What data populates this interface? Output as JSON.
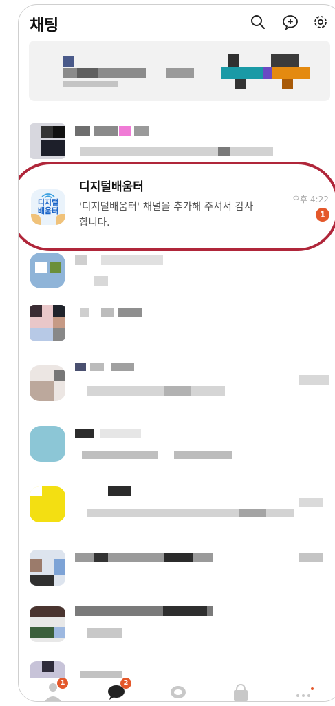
{
  "header": {
    "title": "채팅",
    "icons": [
      "search-icon",
      "new-chat-icon",
      "settings-icon"
    ]
  },
  "highlighted_chat": {
    "avatar_logo_text": "디지털\n배움터",
    "name": "디지털배움터",
    "preview": "'디지털배움터' 채널을 추가해 주셔서 감사합니다.",
    "time": "오후 4:22",
    "unread_count": "1",
    "highlight_color": "#b0263a"
  },
  "tabbar": {
    "tabs": [
      {
        "name": "friends",
        "icon": "person-icon",
        "badge": "1"
      },
      {
        "name": "chats",
        "icon": "chat-bubble-icon",
        "badge": "2",
        "active": true
      },
      {
        "name": "open-chat",
        "icon": "open-chat-icon"
      },
      {
        "name": "shopping",
        "icon": "shopping-bag-icon"
      },
      {
        "name": "more",
        "icon": "more-icon"
      }
    ]
  },
  "colors": {
    "accent": "#e4582b",
    "title": "#111111",
    "subtext": "#555555"
  }
}
